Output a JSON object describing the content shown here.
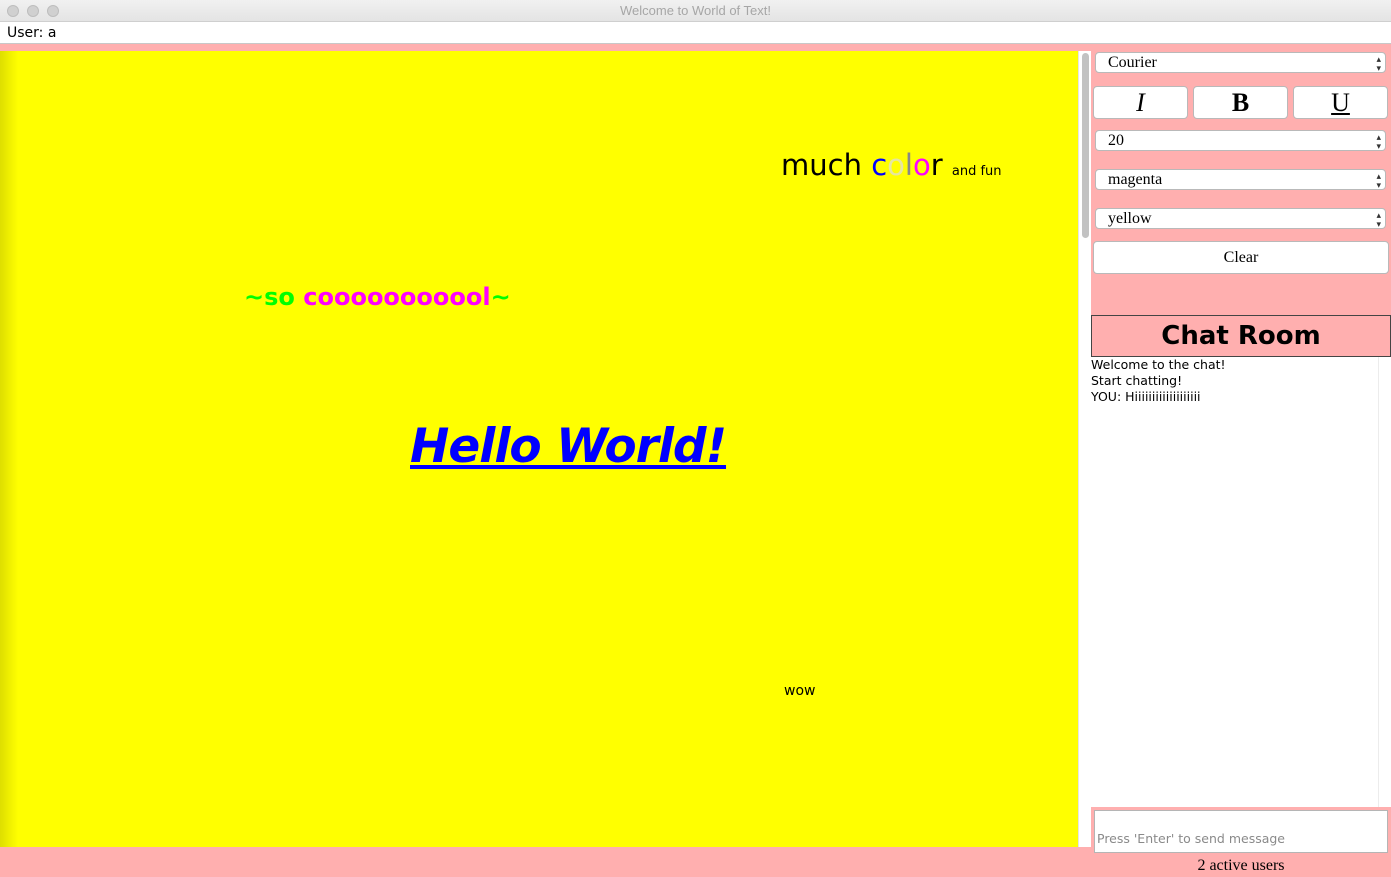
{
  "window": {
    "title": "Welcome to World of Text!"
  },
  "userbar": {
    "label": "User: a"
  },
  "canvas": {
    "background_color": "#ffff00",
    "texts": {
      "much": "much",
      "c": "c",
      "o1": "o",
      "l": "l",
      "o2": "o",
      "r": "r",
      "and_fun": "and fun",
      "so_tilde": "~so",
      "cooool": "cooooooooool",
      "end_tilde": "~",
      "hello_world": "Hello World!",
      "wow": "wow"
    }
  },
  "controls": {
    "font_select": "Courier",
    "italic_label": "I",
    "bold_label": "B",
    "underline_label": "U",
    "size_select": "20",
    "text_color_select": "magenta",
    "bg_color_select": "yellow",
    "clear_label": "Clear"
  },
  "chat": {
    "title": "Chat Room",
    "messages": [
      "Welcome to the chat!",
      "Start chatting!",
      "YOU: Hiiiiiiiiiiiiiiiiiii"
    ],
    "input_placeholder": "Press 'Enter' to send message",
    "active_users": "2 active users"
  }
}
